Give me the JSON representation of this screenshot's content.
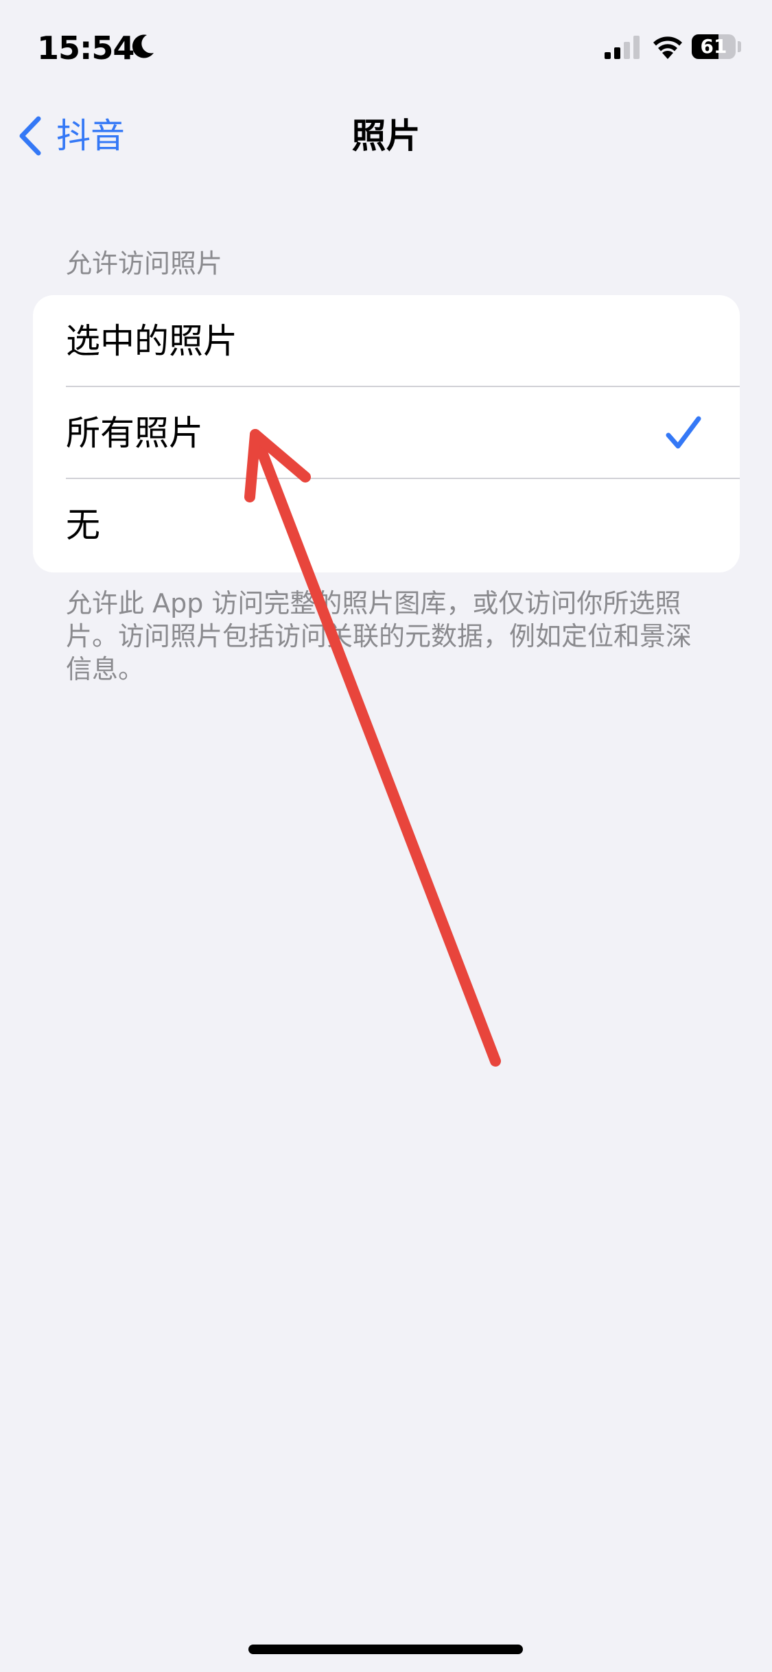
{
  "status_bar": {
    "time": "15:54",
    "battery_level": "61",
    "battery_fraction": 0.61,
    "icons": [
      "moon-icon",
      "signal-icon",
      "wifi-icon",
      "battery-icon"
    ]
  },
  "nav": {
    "back_label": "抖音",
    "title": "照片"
  },
  "section": {
    "header": "允许访问照片",
    "options": [
      {
        "label": "选中的照片",
        "selected": false
      },
      {
        "label": "所有照片",
        "selected": true
      },
      {
        "label": "无",
        "selected": false
      }
    ],
    "footer": "允许此 App 访问完整的照片图库，或仅访问你所选照片。访问照片包括访问关联的元数据，例如定位和景深信息。"
  },
  "colors": {
    "accent": "#3478f6",
    "background": "#f2f2f7",
    "annotation": "#e8453c"
  }
}
